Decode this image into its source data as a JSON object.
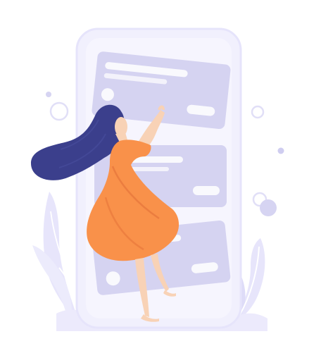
{
  "illustration": {
    "subject": "woman-arranging-cards-on-phone",
    "colors": {
      "phone_body": "#f1f0fd",
      "phone_outline": "#e6e4fb",
      "card": "#d5d3f1",
      "card_line": "#ffffff",
      "hair": "#3b3f8c",
      "dress": "#f9914a",
      "dress_shadow": "#e6753a",
      "skin": "#f8d2b6",
      "leaf": "#e7e5fb",
      "leaf_outline": "#ffffff",
      "bubble": "#d6d4f2"
    }
  }
}
